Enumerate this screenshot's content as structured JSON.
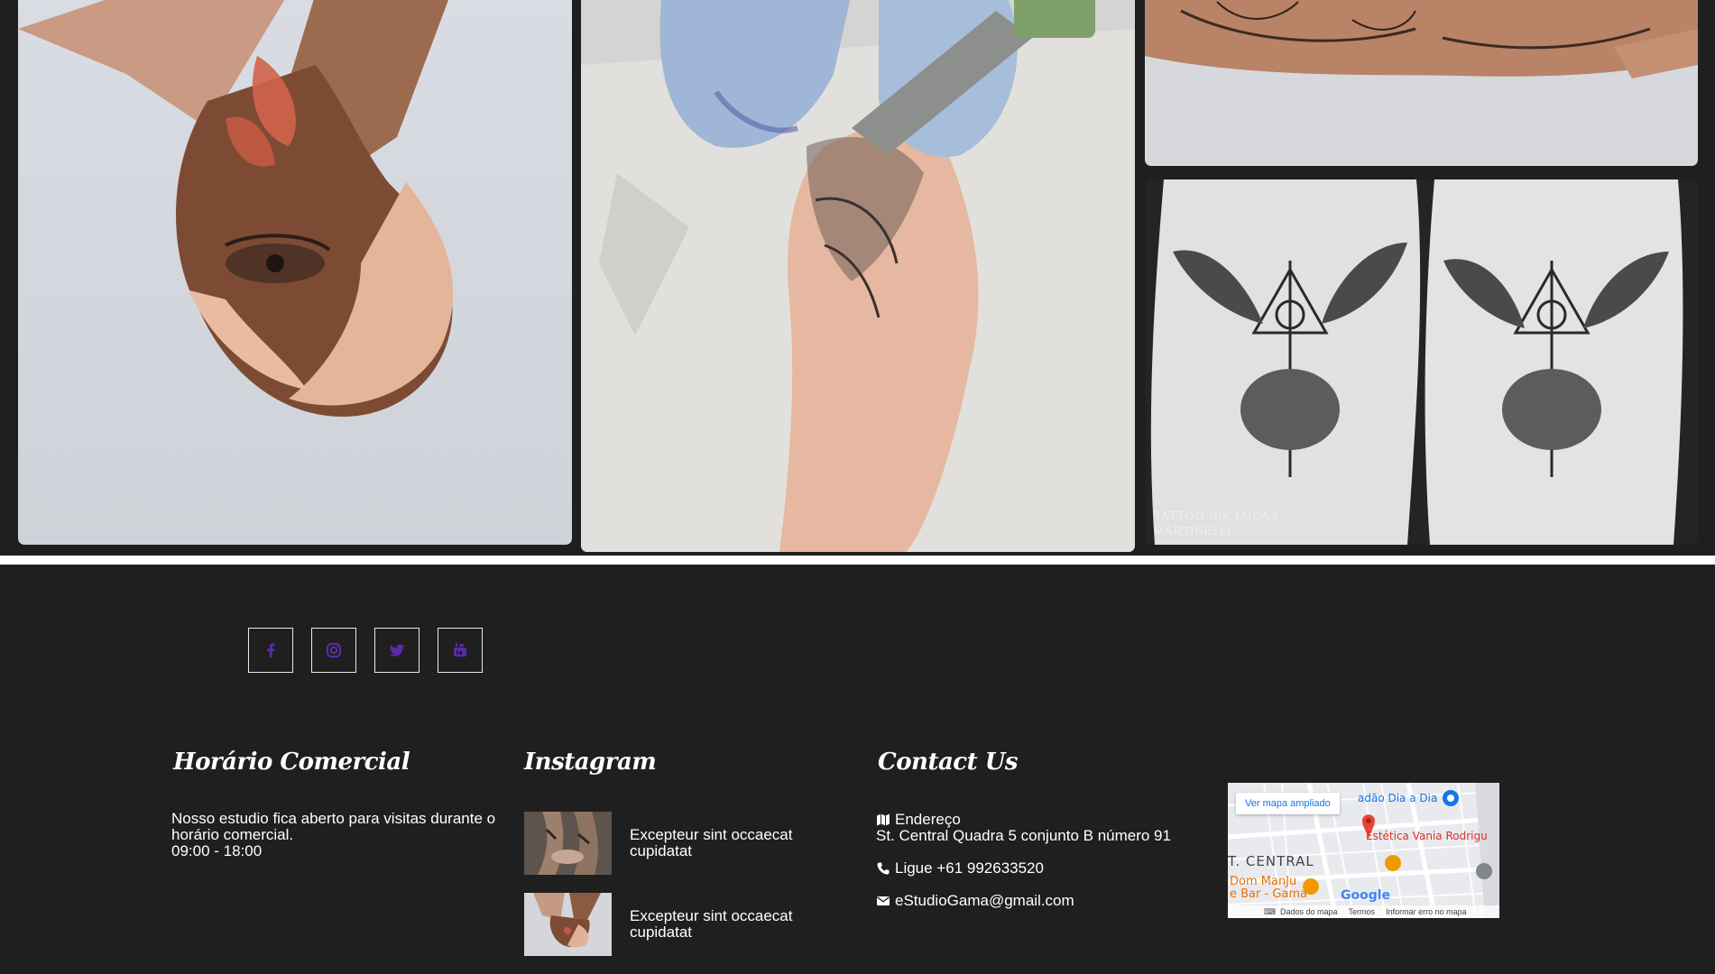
{
  "gallery": {
    "images": [
      {
        "name": "clasped-hands-tattoo"
      },
      {
        "name": "tattooing-forearm"
      },
      {
        "name": "hand-tattoo-partial"
      },
      {
        "name": "deathly-hallows-tattoos",
        "watermark": "TATTOO INK LUCAS MARTINELLI"
      }
    ]
  },
  "social": {
    "accent": "#5b2aa8",
    "links": [
      {
        "icon": "facebook-icon"
      },
      {
        "icon": "instagram-icon"
      },
      {
        "icon": "twitter-icon"
      },
      {
        "icon": "youtube-icon"
      }
    ]
  },
  "footer": {
    "hours": {
      "title": "Horário Comercial",
      "text": "Nosso estudio fica aberto para visitas durante o horário comercial.",
      "time": "09:00 - 18:00"
    },
    "instagram": {
      "title": "Instagram",
      "items": [
        {
          "caption": "Excepteur sint occaecat cupidatat"
        },
        {
          "caption": "Excepteur sint occaecat cupidatat"
        }
      ]
    },
    "contact": {
      "title": "Contact Us",
      "address_label": "Endereço",
      "address": "St. Central Quadra 5 conjunto B número 91",
      "phone": "Ligue +61 992633520",
      "email": "eStudioGama@gmail.com"
    },
    "map": {
      "link": "Ver mapa ampliado",
      "labels": {
        "market": "adão Dia a Dia",
        "place": "Estética Vania Rodrigu",
        "district": "T. CENTRAL",
        "restaurant": "Dom ManJu\ne Bar - Gama",
        "google": "Google"
      },
      "footer": [
        "Dados do mapa",
        "Termos",
        "Informar erro no mapa"
      ]
    }
  }
}
